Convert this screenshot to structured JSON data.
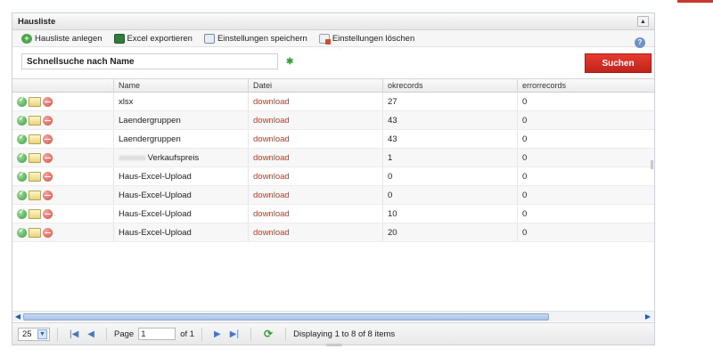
{
  "panel": {
    "title": "Hausliste"
  },
  "toolbar": {
    "add_label": "Hausliste anlegen",
    "excel_label": "Excel exportieren",
    "save_settings_label": "Einstellungen speichern",
    "delete_settings_label": "Einstellungen löschen"
  },
  "search": {
    "value": "Schnellsuche nach Name",
    "button_label": "Suchen"
  },
  "grid": {
    "columns": [
      "",
      "Name",
      "Datei",
      "okrecords",
      "errorrecords"
    ],
    "rows": [
      {
        "name": "xlsx",
        "file": "download",
        "ok": "27",
        "err": "0"
      },
      {
        "name": "Laendergruppen",
        "file": "download",
        "ok": "43",
        "err": "0"
      },
      {
        "name": "Laendergruppen",
        "file": "download",
        "ok": "43",
        "err": "0"
      },
      {
        "name": "Verkaufspreis",
        "name_prefix_blurred": "xxxxxxxx",
        "file": "download",
        "ok": "1",
        "err": "0"
      },
      {
        "name": "Haus-Excel-Upload",
        "file": "download",
        "ok": "0",
        "err": "0"
      },
      {
        "name": "Haus-Excel-Upload",
        "file": "download",
        "ok": "0",
        "err": "0"
      },
      {
        "name": "Haus-Excel-Upload",
        "file": "download",
        "ok": "10",
        "err": "0"
      },
      {
        "name": "Haus-Excel-Upload",
        "file": "download",
        "ok": "20",
        "err": "0"
      }
    ]
  },
  "pager": {
    "page_size": "25",
    "page_label": "Page",
    "page_value": "1",
    "of_label": "of 1",
    "display_text": "Displaying 1 to 8 of 8 items"
  },
  "colors": {
    "accent_red": "#c8372d",
    "link": "#b3402a",
    "scroll_blue": "#a9c3e6"
  }
}
